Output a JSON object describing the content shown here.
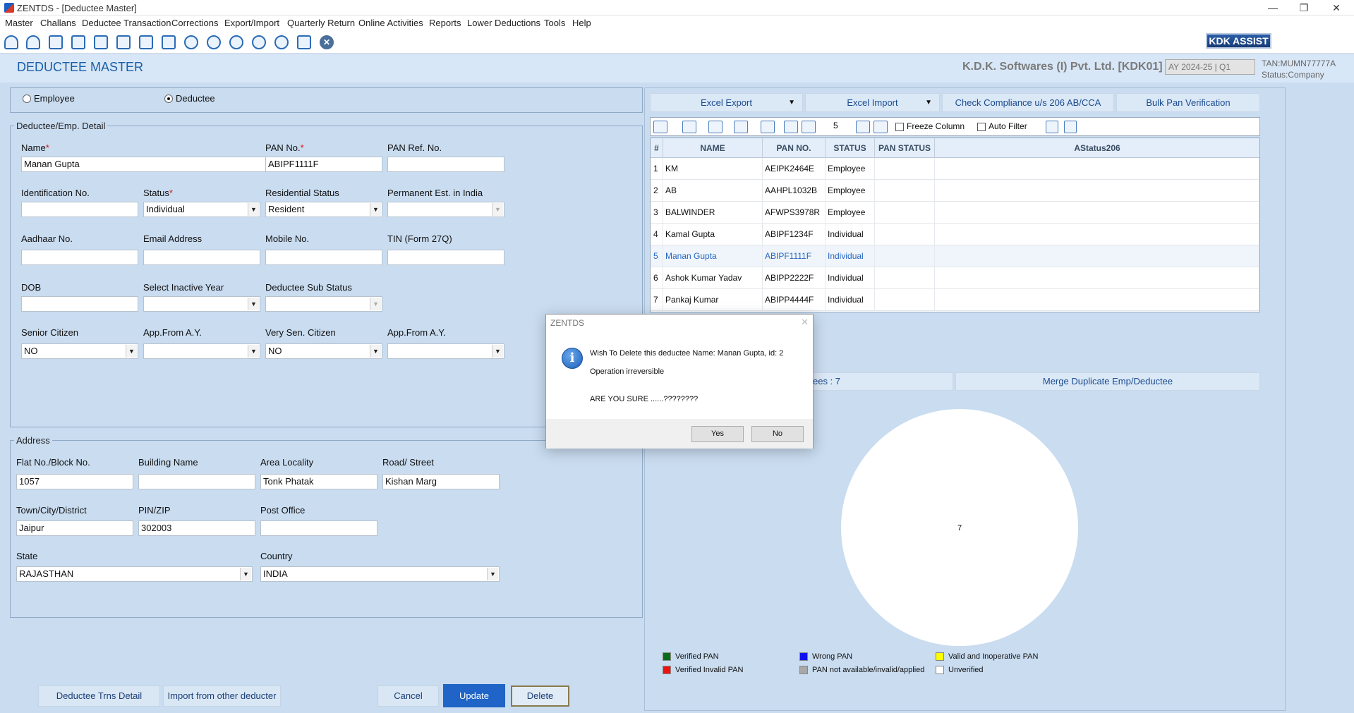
{
  "window": {
    "title": "ZENTDS - [Deductee Master]"
  },
  "menu": [
    "Master",
    "Challans",
    "Deductee Transaction",
    "Corrections",
    "Export/Import",
    "Quarterly Return",
    "Online Activities",
    "Reports",
    "Lower Deductions",
    "Tools",
    "Help"
  ],
  "toolbar": {
    "icons": [
      "group-icon",
      "users-icon",
      "deductee-icon",
      "employee-icon",
      "form24q-icon",
      "form26q-icon",
      "form27q-icon",
      "form27eq-icon",
      "tds24q-icon",
      "tds26q-icon",
      "tds27q-icon",
      "tds27eq-icon",
      "tds-logo-icon",
      "report-icon",
      "close-icon"
    ],
    "assist_label": "KDK ASSIST"
  },
  "header": {
    "title": "DEDUCTEE MASTER",
    "company": "K.D.K. Softwares (I) Pvt. Ltd. [KDK01]",
    "ay": "AY 2024-25 | Q1",
    "tan": "TAN:MUMN77777A",
    "status": "Status:Company"
  },
  "type_select": {
    "employee_label": "Employee",
    "deductee_label": "Deductee",
    "selected": "Deductee"
  },
  "detail": {
    "legend": "Deductee/Emp. Detail",
    "name_label": "Name",
    "name_value": "Manan Gupta",
    "pan_label": "PAN No.",
    "pan_value": "ABIPF1111F",
    "panref_label": "PAN Ref. No.",
    "panref_value": "",
    "idno_label": "Identification No.",
    "idno_value": "",
    "status_label": "Status",
    "status_value": "Individual",
    "resstatus_label": "Residential Status",
    "resstatus_value": "Resident",
    "permest_label": "Permanent Est. in India",
    "permest_value": "",
    "aadhaar_label": "Aadhaar No.",
    "aadhaar_value": "",
    "email_label": "Email Address",
    "email_value": "",
    "mobile_label": "Mobile No.",
    "mobile_value": "",
    "tin_label": "TIN (Form 27Q)",
    "tin_value": "",
    "dob_label": "DOB",
    "dob_value": "",
    "inactive_label": "Select Inactive Year",
    "inactive_value": "",
    "substatus_label": "Deductee Sub Status",
    "substatus_value": "",
    "senior_label": "Senior Citizen",
    "senior_value": "NO",
    "appfrom1_label": "App.From A.Y.",
    "appfrom1_value": "",
    "verysen_label": "Very Sen. Citizen",
    "verysen_value": "NO",
    "appfrom2_label": "App.From A.Y.",
    "appfrom2_value": ""
  },
  "address": {
    "legend": "Address",
    "flat_label": "Flat No./Block No.",
    "flat_value": "1057",
    "building_label": "Building Name",
    "building_value": "",
    "area_label": "Area Locality",
    "area_value": "Tonk Phatak",
    "road_label": "Road/ Street",
    "road_value": "Kishan Marg",
    "town_label": "Town/City/District",
    "town_value": "Jaipur",
    "pin_label": "PIN/ZIP",
    "pin_value": "302003",
    "post_label": "Post Office",
    "post_value": "",
    "state_label": "State",
    "state_value": "RAJASTHAN",
    "country_label": "Country",
    "country_value": "INDIA"
  },
  "bottom_buttons": {
    "trns_detail": "Deductee Trns Detail",
    "import_other": "Import from other deducter",
    "cancel": "Cancel",
    "update": "Update",
    "delete": "Delete"
  },
  "right": {
    "excel_export": "Excel Export",
    "excel_import": "Excel Import",
    "check_compliance": "Check Compliance u/s 206 AB/CCA",
    "bulk_pan": "Bulk Pan Verification",
    "page_number": "5",
    "freeze_column": "Freeze Column",
    "auto_filter": "Auto Filter",
    "columns": [
      "#",
      "NAME",
      "PAN NO.",
      "STATUS",
      "PAN STATUS",
      "AStatus206"
    ],
    "rows": [
      [
        "1",
        "KM",
        "AEIPK2464E",
        "Employee",
        "",
        ""
      ],
      [
        "2",
        "AB",
        "AAHPL1032B",
        "Employee",
        "",
        ""
      ],
      [
        "3",
        "BALWINDER",
        "AFWPS3978R",
        "Employee",
        "",
        ""
      ],
      [
        "4",
        "Kamal Gupta",
        "ABIPF1234F",
        "Individual",
        "",
        ""
      ],
      [
        "5",
        "Manan Gupta",
        "ABIPF1111F",
        "Individual",
        "",
        ""
      ],
      [
        "6",
        "Ashok Kumar Yadav",
        "ABIPP2222F",
        "Individual",
        "",
        ""
      ],
      [
        "7",
        "Pankaj Kumar",
        "ABIPP4444F",
        "Individual",
        "",
        ""
      ]
    ],
    "selected_row": 4,
    "total_partial": "ees : 7",
    "merge_duplicate": "Merge Duplicate Emp/Deductee"
  },
  "chart_data": {
    "type": "pie",
    "categories": [
      "Verified PAN",
      "Wrong PAN",
      "Valid and Inoperative PAN",
      "Verified Invalid PAN",
      "PAN not available/invalid/applied",
      "Unverified"
    ],
    "values": [
      0,
      0,
      0,
      0,
      0,
      7
    ],
    "colors": [
      "#0b6b1b",
      "#1010ee",
      "#ffff00",
      "#ee1111",
      "#a8a8a8",
      "#ffffff"
    ],
    "data_label": "7",
    "title": ""
  },
  "dialog": {
    "title": "ZENTDS",
    "line1": "Wish To Delete this deductee Name: Manan Gupta, id: 2",
    "line2": "Operation irreversible",
    "line3": "ARE YOU SURE ......????????",
    "yes": "Yes",
    "no": "No"
  }
}
